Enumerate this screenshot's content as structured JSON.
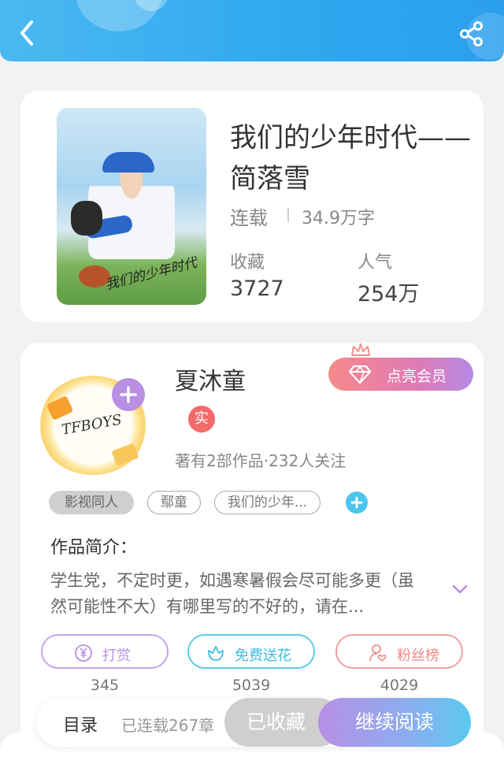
{
  "header": {
    "back_icon": "chevron-left-icon",
    "share_icon": "share-icon",
    "accent": "#2fa8ef"
  },
  "book": {
    "title": "我们的少年时代——简落雪",
    "cover_text": "我们的少年时代",
    "status": "连载",
    "word_count": "34.9万字",
    "stats": [
      {
        "label": "收藏",
        "value": "3727"
      },
      {
        "label": "人气",
        "value": "254万"
      }
    ]
  },
  "author": {
    "name": "夏沐童",
    "verified_badge": "实",
    "meta": "著有2部作品·232人关注",
    "avatar_text": "TFBOYS",
    "vip_button": "点亮会员",
    "tags": [
      "影视同人",
      "鄢童",
      "我们的少年..."
    ],
    "intro_label": "作品简介：",
    "intro_text": "学生党，不定时更，如遇寒暑假会尽可能多更（虽然可能性不大）有哪里写的不好的，请在...",
    "actions": [
      {
        "label": "打赏",
        "count": "345",
        "icon": "yen-icon",
        "color": "#b88fe2"
      },
      {
        "label": "免费送花",
        "count": "5039",
        "icon": "flower-icon",
        "color": "#3cbfe0"
      },
      {
        "label": "粉丝榜",
        "count": "4029",
        "icon": "user-heart-icon",
        "color": "#ef8a8a"
      }
    ]
  },
  "bottom_bar": {
    "catalog_label": "目录",
    "catalog_status": "已连载267章",
    "collected_label": "已收藏",
    "read_label": "继续阅读"
  }
}
